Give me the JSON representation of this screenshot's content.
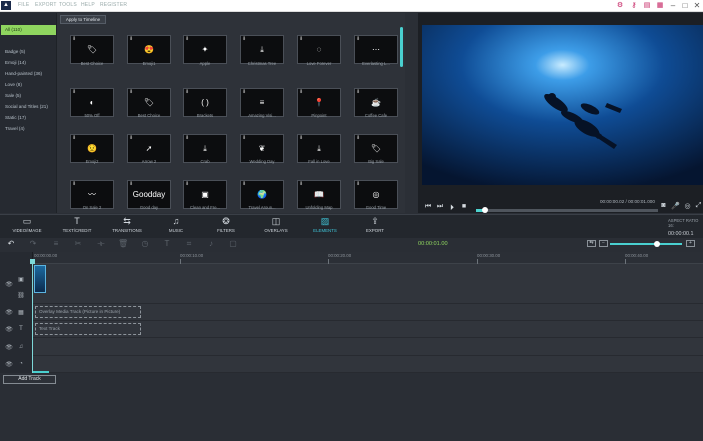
{
  "menubar": {
    "logo": "",
    "items": [
      "FILE",
      "EXPORT",
      "TOOLS",
      "HELP",
      "REGISTER"
    ]
  },
  "categories": [
    {
      "label": "All (110)",
      "active": true
    },
    {
      "label": "Badge (5)"
    },
    {
      "label": "Emoji (14)"
    },
    {
      "label": "Hand-painted (36)"
    },
    {
      "label": "Love (8)"
    },
    {
      "label": "Sale (5)"
    },
    {
      "label": "Social and Titles (21)"
    },
    {
      "label": "Static (17)"
    },
    {
      "label": "Travel (4)"
    }
  ],
  "apply_button": "Apply to Timeline",
  "elements": [
    {
      "label": "Best Choice",
      "glyph": "🏷"
    },
    {
      "label": "Emoji1",
      "glyph": "😍"
    },
    {
      "label": "Apple",
      "glyph": "✦"
    },
    {
      "label": "Christmas Tree",
      "glyph": "⤓"
    },
    {
      "label": "Love Forever",
      "glyph": "◌"
    },
    {
      "label": "Everlasting L...",
      "glyph": "⋯"
    },
    {
      "label": "50% Off",
      "glyph": "◐"
    },
    {
      "label": "Best Choice",
      "glyph": "🏷"
    },
    {
      "label": "Brackets",
      "glyph": "( )"
    },
    {
      "label": "Amazing Visi...",
      "glyph": "≡"
    },
    {
      "label": "Pinpoint",
      "glyph": "📍"
    },
    {
      "label": "Coffee Cafe",
      "glyph": "☕"
    },
    {
      "label": "Emoji2",
      "glyph": "😟"
    },
    {
      "label": "Arrow 2",
      "glyph": "➚"
    },
    {
      "label": "Crab",
      "glyph": "⤓"
    },
    {
      "label": "Wedding Day",
      "glyph": "❦"
    },
    {
      "label": "Fall in Love",
      "glyph": "⤓"
    },
    {
      "label": "Big Sale",
      "glyph": "🏷"
    },
    {
      "label": "On Sale 2",
      "glyph": "〰"
    },
    {
      "label": "Good day",
      "glyph": "Goodday"
    },
    {
      "label": "Clean and Fre...",
      "glyph": "▣"
    },
    {
      "label": "Travel Aroun...",
      "glyph": "🌍"
    },
    {
      "label": "Unfolding Map",
      "glyph": "📖"
    },
    {
      "label": "Good Time",
      "glyph": "◎"
    }
  ],
  "preview": {
    "time": "00:00:00.02 / 00:00:01.000",
    "progress": 0.05
  },
  "nav": [
    {
      "icon": "▭",
      "label": "VIDEO/IMAGE"
    },
    {
      "icon": "T",
      "label": "TEXT/CREDIT"
    },
    {
      "icon": "⇆",
      "label": "TRANSITIONS"
    },
    {
      "icon": "♫",
      "label": "MUSIC"
    },
    {
      "icon": "❂",
      "label": "FILTERS"
    },
    {
      "icon": "◫",
      "label": "OVERLAYS"
    },
    {
      "icon": "▨",
      "label": "ELEMENTS",
      "active": true
    },
    {
      "icon": "⇪",
      "label": "EXPORT"
    }
  ],
  "aspect": {
    "label": "ASPECT RATIO 16:",
    "time": "00:00:00.1"
  },
  "timeline": {
    "current": "00:00:01.00",
    "ticks": [
      "00:00:00.00",
      "00:00:10.00",
      "00:00:20.00",
      "00:00:30.00",
      "00:00:40.00"
    ],
    "overlay_track": "Overlay Media Track (Picture in Picture)",
    "text_track": "Text Track",
    "add_track": "Add Track",
    "zoom": 0.65
  },
  "colors": {
    "accent": "#4ad0d0",
    "active_category": "#8fd55f"
  }
}
